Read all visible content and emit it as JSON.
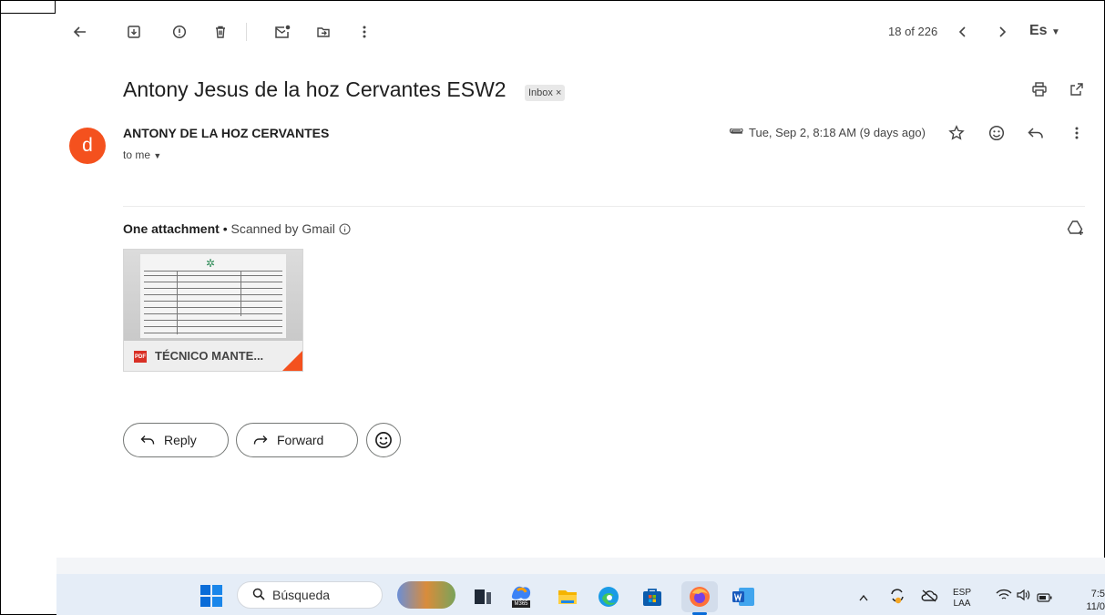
{
  "toolbar": {
    "count": "18 of 226",
    "lang": "Es",
    "icons": [
      "back-arrow-icon",
      "archive-icon",
      "report-spam-icon",
      "delete-icon",
      "mark-unread-icon",
      "move-to-icon",
      "more-vert-icon",
      "chevron-left-icon",
      "chevron-right-icon"
    ]
  },
  "email": {
    "subject": "Antony Jesus de la hoz Cervantes ESW2",
    "label_badge": "Inbox ×",
    "avatar_letter": "d",
    "sender": "ANTONY DE LA HOZ CERVANTES",
    "recipient": "to me",
    "date": "Tue, Sep 2, 8:18 AM (9 days ago)"
  },
  "attachments": {
    "heading": "One attachment",
    "separator": "•",
    "scanned": "Scanned by Gmail",
    "file_name": "TÉCNICO MANTE...",
    "file_type": "PDF"
  },
  "actions": {
    "reply": "Reply",
    "forward": "Forward"
  },
  "taskbar": {
    "search_placeholder": "Búsqueda",
    "m365_label": "M365",
    "lang_top": "ESP",
    "lang_bottom": "LAA",
    "time": "7:5",
    "date": "11/0"
  },
  "colors": {
    "avatar": "#f4511e",
    "pdf": "#d93025",
    "taskbar": "#e5edf7"
  }
}
